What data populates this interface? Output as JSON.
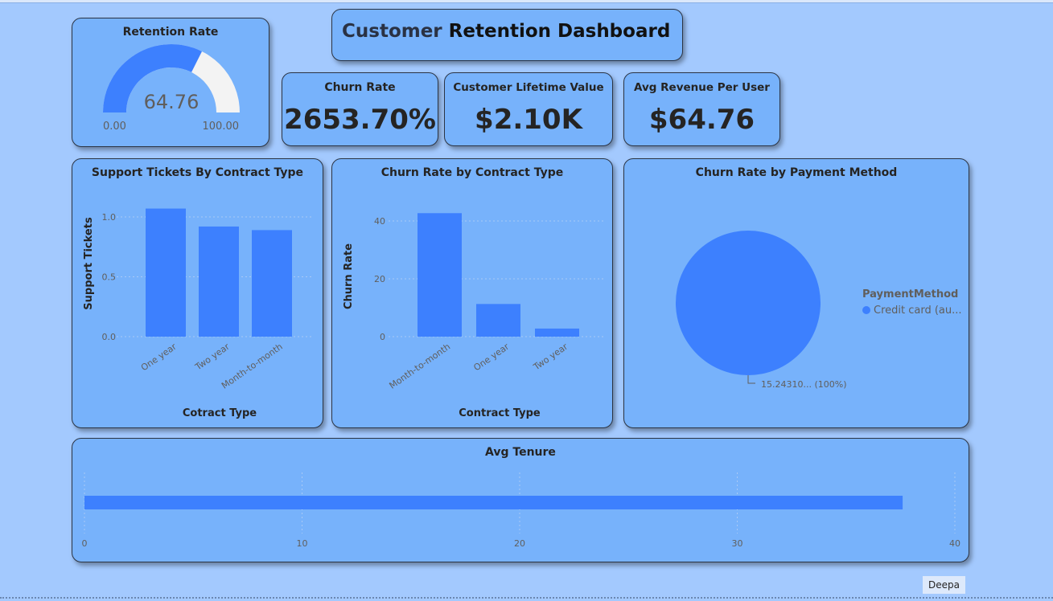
{
  "dashboard": {
    "title_part1": "Customer",
    "title_part2": "Retention Dashboard",
    "author": "Deepa"
  },
  "colors": {
    "background": "#a3c9fe",
    "card": "#77b2fb",
    "bar": "#3d80fe",
    "gauge_track": "#f3f3f3"
  },
  "gauge": {
    "title": "Retention Rate",
    "value_label": "64.76",
    "min_label": "0.00",
    "max_label": "100.00"
  },
  "kpis": {
    "churn_rate": {
      "title": "Churn Rate",
      "value": "2653.70%"
    },
    "clv": {
      "title": "Customer Lifetime Value",
      "value": "$2.10K"
    },
    "arpu": {
      "title": "Avg Revenue Per User",
      "value": "$64.76"
    }
  },
  "chart_data": [
    {
      "id": "support_tickets",
      "type": "bar",
      "title": "Support Tickets By Contract Type",
      "xlabel": "Cotract Type",
      "ylabel": "Support Tickets",
      "categories": [
        "One year",
        "Two year",
        "Month-to-month"
      ],
      "values": [
        1.07,
        0.92,
        0.89
      ],
      "ylim": [
        0,
        1.0
      ],
      "yticks": [
        "0.0",
        "0.5",
        "1.0"
      ],
      "grid": true
    },
    {
      "id": "churn_by_contract",
      "type": "bar",
      "title": "Churn Rate by Contract Type",
      "xlabel": "Contract Type",
      "ylabel": "Churn Rate",
      "categories": [
        "Month-to-month",
        "One year",
        "Two year"
      ],
      "values": [
        42.7,
        11.3,
        2.8
      ],
      "ylim": [
        0,
        40
      ],
      "yticks": [
        "0",
        "20",
        "40"
      ],
      "grid": true
    },
    {
      "id": "churn_by_payment",
      "type": "pie",
      "title": "Churn Rate by Payment Method",
      "legend_title": "PaymentMethod",
      "legend_position": "right",
      "slices": [
        {
          "name": "Credit card (au...",
          "value": 100,
          "data_label": "15.24310... (100%)"
        }
      ]
    },
    {
      "id": "avg_tenure",
      "type": "bar",
      "orientation": "horizontal",
      "title": "Avg Tenure",
      "values": [
        37.6
      ],
      "xlim": [
        0,
        40
      ],
      "xticks": [
        "0",
        "10",
        "20",
        "30",
        "40"
      ],
      "grid": true
    }
  ]
}
